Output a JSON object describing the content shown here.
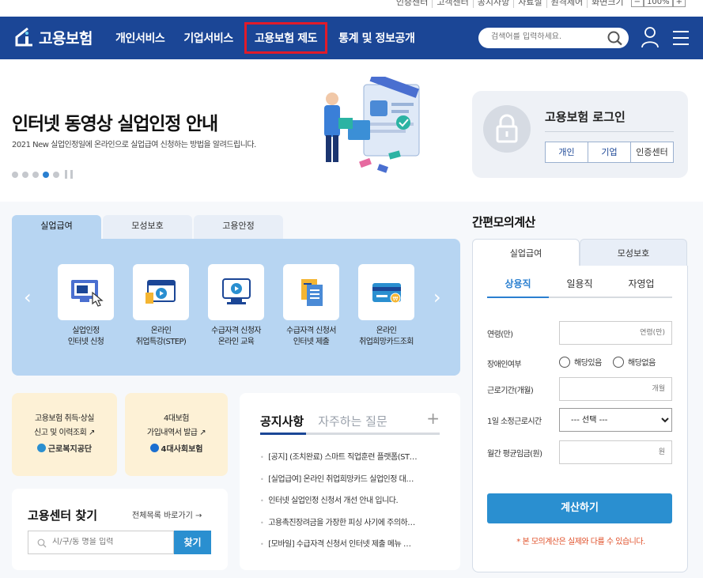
{
  "util": {
    "links": [
      "인증센터",
      "고객센터",
      "공지사항",
      "자료실",
      "원격제어",
      "화면크기"
    ],
    "zoom_minus": "−",
    "zoom_value": "100%",
    "zoom_plus": "+"
  },
  "header": {
    "logo_text": "고용보험",
    "nav": [
      "개인서비스",
      "기업서비스",
      "고용보험 제도",
      "통계 및 정보공개"
    ],
    "search_placeholder": "검색어를 입력하세요."
  },
  "hero": {
    "title": "인터넷 동영상 실업인정 안내",
    "desc": "2021 New 실업인정일에 온라인으로 실업급여 신청하는 방법을 알려드립니다."
  },
  "login": {
    "title": "고용보험 로그인",
    "buttons": [
      "개인",
      "기업",
      "인증센터"
    ]
  },
  "services": {
    "tabs": [
      "실업급여",
      "모성보호",
      "고용안정"
    ],
    "items": [
      {
        "label": "실업인정\n인터넷 신청"
      },
      {
        "label": "온라인\n취업특강(STEP)"
      },
      {
        "label": "수급자격 신청자\n온라인 교육"
      },
      {
        "label": "수급자격 신청서\n인터넷 제출"
      },
      {
        "label": "온라인\n취업희망카드조회"
      }
    ]
  },
  "cards": [
    {
      "text": "고용보험 취득·상실\n신고 및 이력조회",
      "logo": "근로복지공단"
    },
    {
      "text": "4대보험\n가입내역서 발급",
      "logo": "4대사회보험"
    }
  ],
  "center": {
    "title": "고용센터 찾기",
    "link": "전체목록 바로가기 →",
    "placeholder": "시/구/동 명을 입력",
    "button": "찾기"
  },
  "notice": {
    "tabs": [
      "공지사항",
      "자주하는 질문"
    ],
    "plus": "+",
    "items": [
      "[공지] (조치완료) 스마트 직업훈련 플랫폼(ST…",
      "[실업급여] 온라인 취업희망카드 실업인정 대…",
      "인터넷 실업인정 신청서 개선 안내 입니다.",
      "고용촉진장려금을 가장한 피싱 사기에 주의하…",
      "[모바일] 수급자격 신청서 인터넷 제출 메뉴 …"
    ]
  },
  "calc": {
    "title": "간편모의계산",
    "tabs": [
      "실업급여",
      "모성보호"
    ],
    "sub_tabs": [
      "상용직",
      "일용직",
      "자영업"
    ],
    "age_label": "연령(만)",
    "age_placeholder": "연령(만)",
    "disability_label": "장애인여부",
    "disability_yes": "해당있음",
    "disability_no": "해당없음",
    "period_label": "근로기간(개월)",
    "period_placeholder": "개월",
    "hours_label": "1일 소정근로시간",
    "hours_select": "--- 선택 ---",
    "wage_label": "월간 평균임금(원)",
    "wage_placeholder": "원",
    "button": "계산하기",
    "note": "* 본 모의계산은 실제와 다를 수 있습니다."
  },
  "colors": {
    "header_bg": "#1b4696",
    "accent": "#2a8fd0",
    "highlight_border": "#e11b2a"
  }
}
